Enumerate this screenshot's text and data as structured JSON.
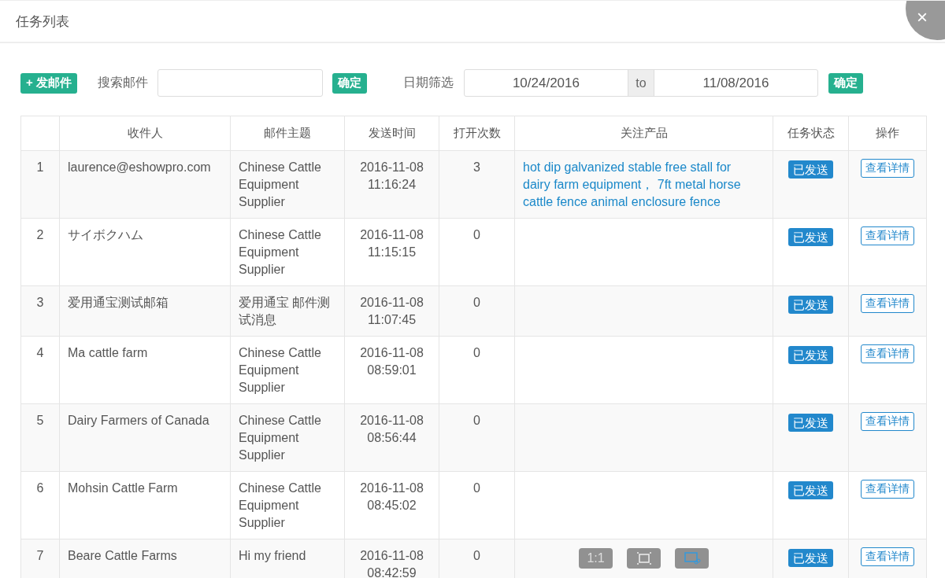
{
  "dialog": {
    "title": "任务列表",
    "close_symbol": "×"
  },
  "toolbar": {
    "compose_button": "+ 发邮件",
    "search_label": "搜索邮件",
    "search_button": "确定",
    "date_label": "日期筛选",
    "date_from": "10/24/2016",
    "date_separator": "to",
    "date_to": "11/08/2016",
    "date_button": "确定"
  },
  "table": {
    "columns": [
      "",
      "收件人",
      "邮件主题",
      "发送时间",
      "打开次数",
      "关注产品",
      "任务状态",
      "操作"
    ],
    "rows": [
      {
        "index": "1",
        "recipient": "laurence@eshowpro.com",
        "subject": "Chinese Cattle Equipment Supplier",
        "sent_time": "2016-11-08 11:16:24",
        "opens": "3",
        "products": "hot dip galvanized stable free stall for dairy farm equipment，  7ft metal horse cattle fence animal enclosure fence",
        "status": "已发送",
        "action": "查看详情"
      },
      {
        "index": "2",
        "recipient": "サイボクハム",
        "subject": "Chinese Cattle Equipment Supplier",
        "sent_time": "2016-11-08 11:15:15",
        "opens": "0",
        "status": "已发送",
        "action": "查看详情"
      },
      {
        "index": "3",
        "recipient": "爱用通宝测试邮箱",
        "subject": "爱用通宝 邮件测试消息",
        "sent_time": "2016-11-08 11:07:45",
        "opens": "0",
        "status": "已发送",
        "action": "查看详情"
      },
      {
        "index": "4",
        "recipient": "Ma cattle farm",
        "subject": "Chinese Cattle Equipment Supplier",
        "sent_time": "2016-11-08 08:59:01",
        "opens": "0",
        "status": "已发送",
        "action": "查看详情"
      },
      {
        "index": "5",
        "recipient": "Dairy Farmers of Canada",
        "subject": "Chinese Cattle Equipment Supplier",
        "sent_time": "2016-11-08 08:56:44",
        "opens": "0",
        "status": "已发送",
        "action": "查看详情"
      },
      {
        "index": "6",
        "recipient": "Mohsin Cattle Farm",
        "subject": "Chinese Cattle Equipment Supplier",
        "sent_time": "2016-11-08 08:45:02",
        "opens": "0",
        "status": "已发送",
        "action": "查看详情"
      },
      {
        "index": "7",
        "recipient": "Beare Cattle Farms",
        "subject": "Hi my friend",
        "sent_time": "2016-11-08 08:42:59",
        "opens": "0",
        "status": "已发送",
        "action": "查看详情"
      }
    ]
  },
  "viewer_controls": {
    "actual_size_button": "1:1"
  }
}
